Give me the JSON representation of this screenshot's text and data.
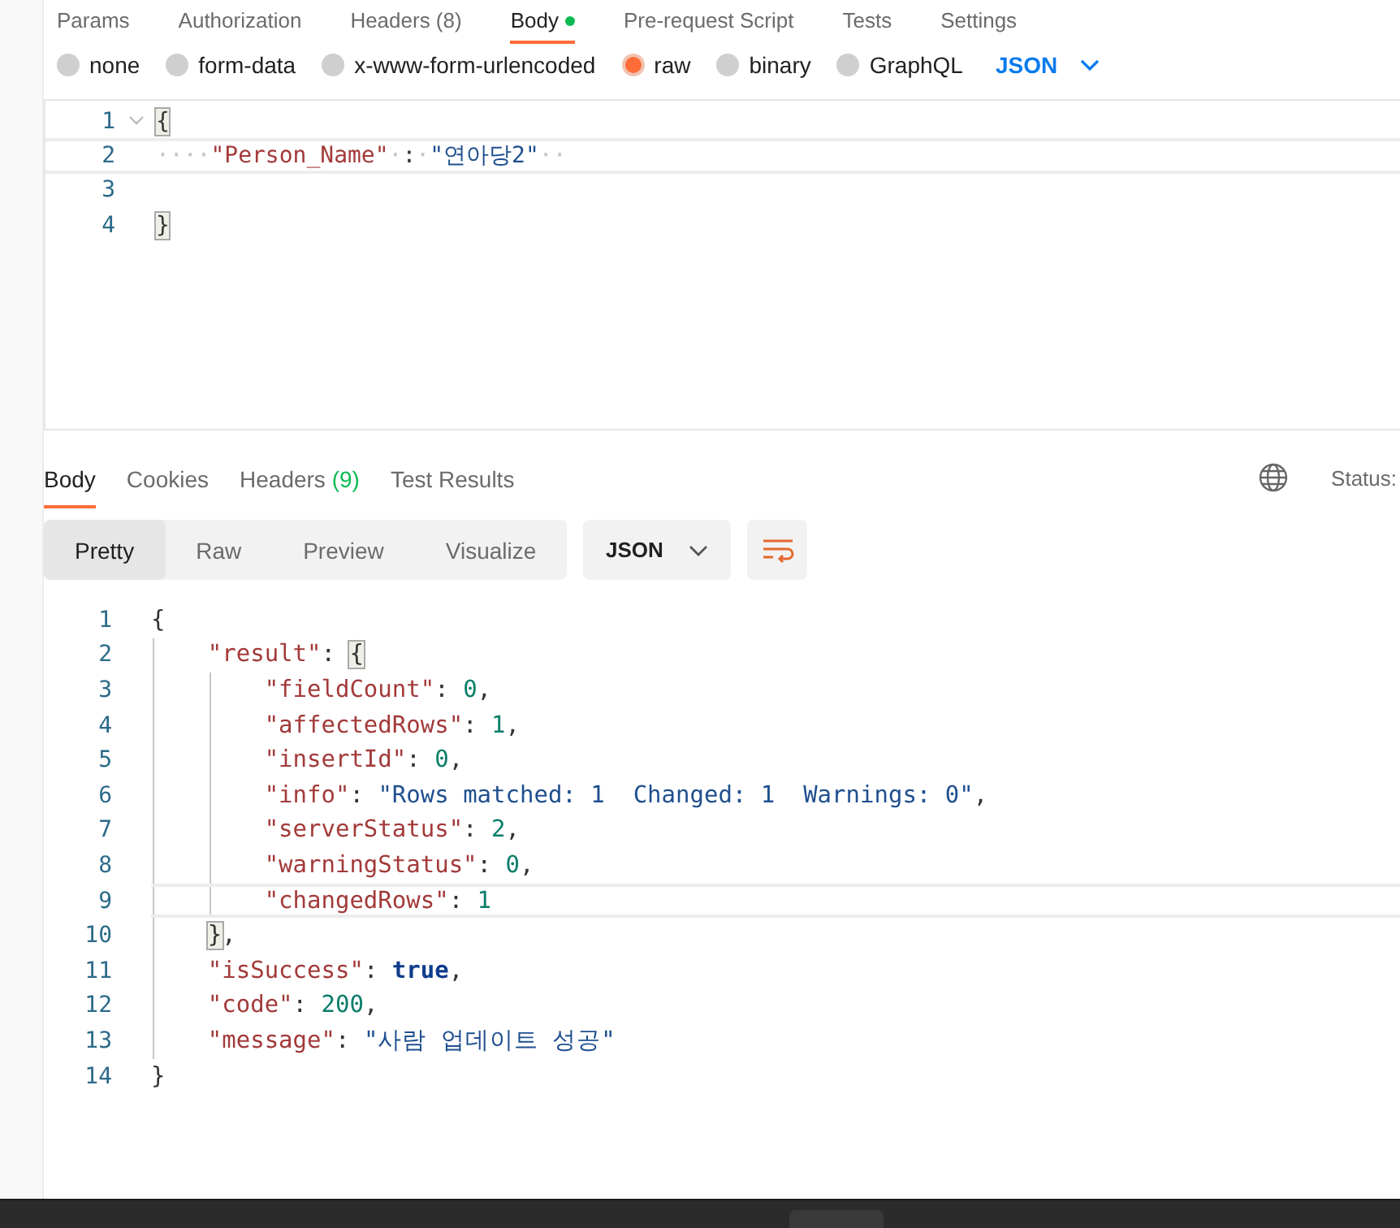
{
  "request_tabs": [
    {
      "label": "Params",
      "selected": false
    },
    {
      "label": "Authorization",
      "selected": false
    },
    {
      "label": "Headers (8)",
      "selected": false
    },
    {
      "label": "Body",
      "selected": true,
      "dot": true
    },
    {
      "label": "Pre-request Script",
      "selected": false
    },
    {
      "label": "Tests",
      "selected": false
    },
    {
      "label": "Settings",
      "selected": false
    }
  ],
  "body_types": [
    {
      "label": "none",
      "selected": false
    },
    {
      "label": "form-data",
      "selected": false
    },
    {
      "label": "x-www-form-urlencoded",
      "selected": false
    },
    {
      "label": "raw",
      "selected": true
    },
    {
      "label": "binary",
      "selected": false
    },
    {
      "label": "GraphQL",
      "selected": false
    }
  ],
  "format_dropdown": "JSON",
  "request_editor": {
    "lines": [
      {
        "number": "1",
        "current": false,
        "foldable": true,
        "tokens": [
          {
            "kind": "bracket-match",
            "text": "{"
          }
        ]
      },
      {
        "number": "2",
        "current": true,
        "foldable": false,
        "tokens": [
          {
            "kind": "ws",
            "text": "····"
          },
          {
            "kind": "key",
            "text": "\"Person_Name\""
          },
          {
            "kind": "ws",
            "text": "·"
          },
          {
            "kind": "punct",
            "text": ":"
          },
          {
            "kind": "ws",
            "text": "·"
          },
          {
            "kind": "string",
            "text": "\"연아당2\""
          },
          {
            "kind": "ws",
            "text": "··"
          }
        ]
      },
      {
        "number": "3",
        "current": false,
        "foldable": false
      },
      {
        "number": "4",
        "current": false,
        "foldable": false,
        "tokens": [
          {
            "kind": "bracket-match",
            "text": "}"
          }
        ]
      }
    ]
  },
  "response_tabs": [
    {
      "label": "Body",
      "selected": true
    },
    {
      "label": "Cookies",
      "selected": false
    },
    {
      "label": "Headers",
      "count": "(9)",
      "selected": false
    },
    {
      "label": "Test Results",
      "selected": false
    }
  ],
  "status_label": "Status:",
  "view_modes": [
    {
      "label": "Pretty",
      "selected": true
    },
    {
      "label": "Raw",
      "selected": false
    },
    {
      "label": "Preview",
      "selected": false
    },
    {
      "label": "Visualize",
      "selected": false
    }
  ],
  "response_format": "JSON",
  "response_editor": {
    "lines": [
      {
        "number": "1",
        "current": false,
        "tokens": [
          {
            "kind": "punct",
            "text": "{"
          }
        ],
        "children": [
          {
            "number": "2",
            "current": false,
            "tokens": [
              {
                "kind": "key",
                "text": "\"result\""
              },
              {
                "kind": "punct",
                "text": ":"
              },
              {
                "kind": "bracket-match",
                "text": "{"
              }
            ],
            "children": [
              {
                "number": "3",
                "current": false,
                "tokens": [
                  {
                    "kind": "key",
                    "text": "\"fieldCount\""
                  },
                  {
                    "kind": "punct",
                    "text": ":"
                  },
                  {
                    "kind": "number",
                    "text": "0"
                  },
                  {
                    "kind": "punct",
                    "text": ","
                  }
                ]
              },
              {
                "number": "4",
                "current": false,
                "tokens": [
                  {
                    "kind": "key",
                    "text": "\"affectedRows\""
                  },
                  {
                    "kind": "punct",
                    "text": ":"
                  },
                  {
                    "kind": "number",
                    "text": "1"
                  },
                  {
                    "kind": "punct",
                    "text": ","
                  }
                ]
              },
              {
                "number": "5",
                "current": false,
                "tokens": [
                  {
                    "kind": "key",
                    "text": "\"insertId\""
                  },
                  {
                    "kind": "punct",
                    "text": ":"
                  },
                  {
                    "kind": "number",
                    "text": "0"
                  },
                  {
                    "kind": "punct",
                    "text": ","
                  }
                ]
              },
              {
                "number": "6",
                "current": false,
                "tokens": [
                  {
                    "kind": "key",
                    "text": "\"info\""
                  },
                  {
                    "kind": "punct",
                    "text": ":"
                  },
                  {
                    "kind": "string",
                    "text": "\"Rows matched: 1  Changed: 1  Warnings: 0\""
                  },
                  {
                    "kind": "punct",
                    "text": ","
                  }
                ]
              },
              {
                "number": "7",
                "current": false,
                "tokens": [
                  {
                    "kind": "key",
                    "text": "\"serverStatus\""
                  },
                  {
                    "kind": "punct",
                    "text": ":"
                  },
                  {
                    "kind": "number",
                    "text": "2"
                  },
                  {
                    "kind": "punct",
                    "text": ","
                  }
                ]
              },
              {
                "number": "8",
                "current": false,
                "tokens": [
                  {
                    "kind": "key",
                    "text": "\"warningStatus\""
                  },
                  {
                    "kind": "punct",
                    "text": ":"
                  },
                  {
                    "kind": "number",
                    "text": "0"
                  },
                  {
                    "kind": "punct",
                    "text": ","
                  }
                ]
              },
              {
                "number": "9",
                "current": true,
                "tokens": [
                  {
                    "kind": "key",
                    "text": "\"changedRows\""
                  },
                  {
                    "kind": "punct",
                    "text": ":"
                  },
                  {
                    "kind": "number",
                    "text": "1"
                  }
                ]
              }
            ]
          },
          {
            "number": "10",
            "current": false,
            "tokens": [
              {
                "kind": "bracket-match",
                "text": "}"
              },
              {
                "kind": "punct",
                "text": ","
              }
            ]
          },
          {
            "number": "11",
            "current": false,
            "tokens": [
              {
                "kind": "key",
                "text": "\"isSuccess\""
              },
              {
                "kind": "punct",
                "text": ":"
              },
              {
                "kind": "bool",
                "text": "true"
              },
              {
                "kind": "punct",
                "text": ","
              }
            ]
          },
          {
            "number": "12",
            "current": false,
            "tokens": [
              {
                "kind": "key",
                "text": "\"code\""
              },
              {
                "kind": "punct",
                "text": ":"
              },
              {
                "kind": "number",
                "text": "200"
              },
              {
                "kind": "punct",
                "text": ","
              }
            ]
          },
          {
            "number": "13",
            "current": false,
            "tokens": [
              {
                "kind": "key",
                "text": "\"message\""
              },
              {
                "kind": "punct",
                "text": ":"
              },
              {
                "kind": "string",
                "text": "\"사람 업데이트 성공\""
              }
            ]
          }
        ]
      },
      {
        "number": "14",
        "current": false,
        "tokens": [
          {
            "kind": "punct",
            "text": "}"
          }
        ]
      }
    ]
  }
}
